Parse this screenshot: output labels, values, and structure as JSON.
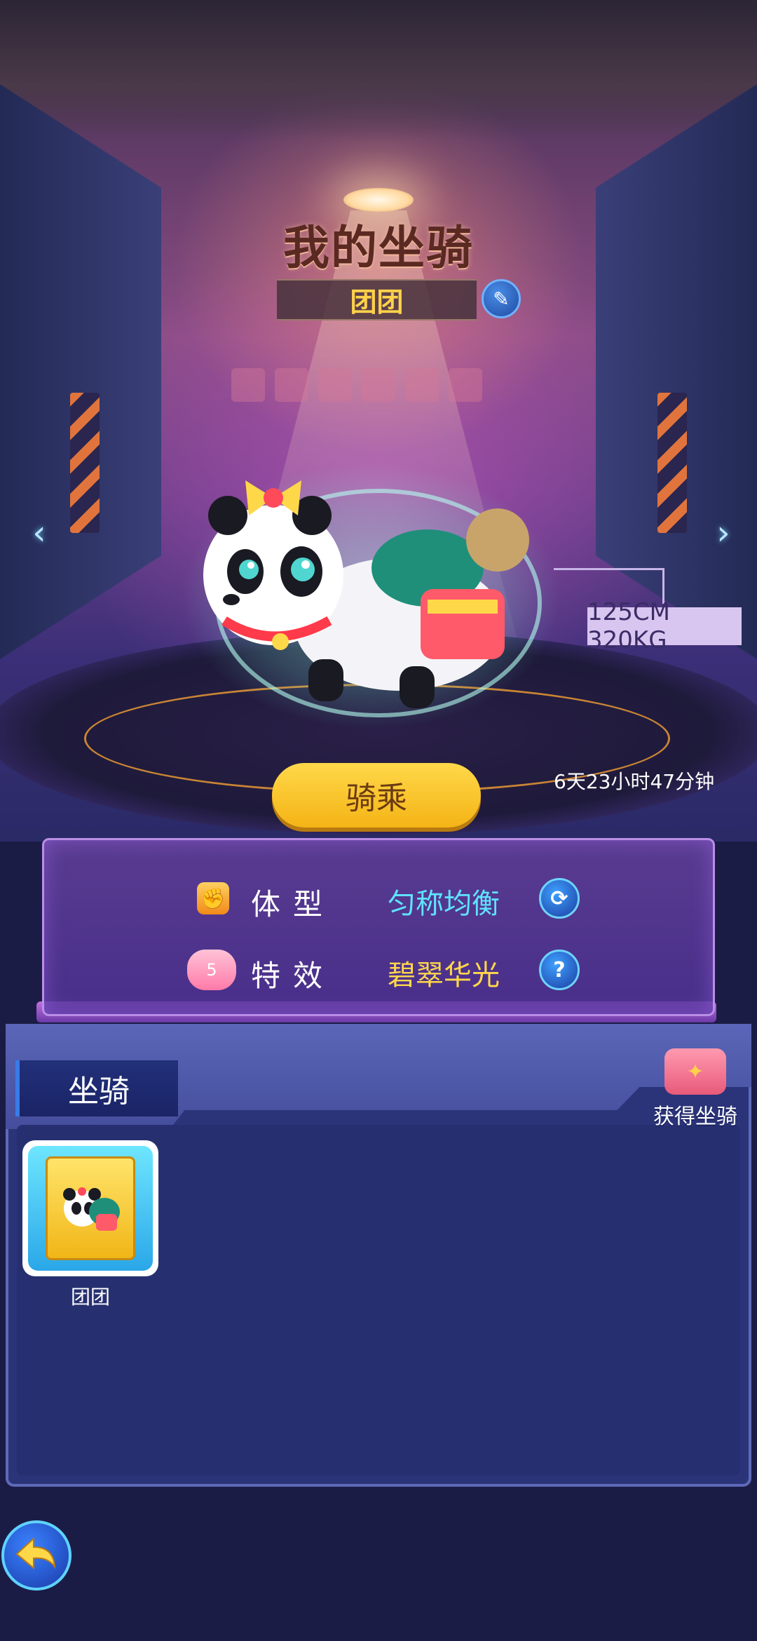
{
  "header": {
    "title": "我的坐骑",
    "mount_name": "团团",
    "edit_icon": "pencil-icon"
  },
  "mount": {
    "size_text": "125CM 320KG",
    "ride_label": "骑乘",
    "timer_text": "6天23小时47分钟"
  },
  "attributes": {
    "body": {
      "label": "体型",
      "value": "匀称均衡",
      "icon": "fist-icon",
      "action_icon": "refresh-icon"
    },
    "effect": {
      "label": "特效",
      "value": "碧翠华光",
      "icon": "level-badge-icon",
      "level": "5",
      "action_icon": "question-icon",
      "action_text": "?"
    }
  },
  "inventory": {
    "tab_label": "坐骑",
    "get_mount_label": "获得坐骑",
    "items": [
      {
        "name": "团团"
      }
    ]
  },
  "navigation": {
    "left_arrow": "‹",
    "right_arrow": "›"
  },
  "colors": {
    "title": "#5a2a22",
    "name_text": "#ffd24a",
    "body_value": "#5fe3ff",
    "effect_value": "#ffd84a",
    "ride_button": "#ffd84a"
  }
}
